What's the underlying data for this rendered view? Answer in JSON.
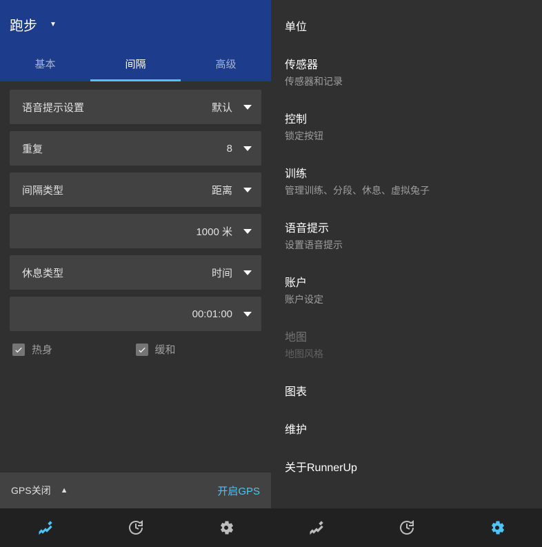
{
  "left": {
    "header": {
      "activity": "跑步"
    },
    "tabs": [
      {
        "label": "基本",
        "active": false
      },
      {
        "label": "间隔",
        "active": true
      },
      {
        "label": "高级",
        "active": false
      }
    ],
    "rows": [
      {
        "label": "语音提示设置",
        "value": "默认"
      },
      {
        "label": "重复",
        "value": "8"
      },
      {
        "label": "间隔类型",
        "value": "距离"
      },
      {
        "label": "",
        "value": "1000 米"
      },
      {
        "label": "休息类型",
        "value": "时间"
      },
      {
        "label": "",
        "value": "00:01:00"
      }
    ],
    "checks": {
      "warmup": "热身",
      "cooldown": "缓和"
    },
    "gps": {
      "status": "GPS关闭",
      "start": "开启GPS"
    }
  },
  "right": {
    "items": [
      {
        "title": "单位",
        "sub": ""
      },
      {
        "title": "传感器",
        "sub": "传感器和记录"
      },
      {
        "title": "控制",
        "sub": "锁定按钮"
      },
      {
        "title": "训练",
        "sub": "管理训练、分段、休息、虚拟兔子"
      },
      {
        "title": "语音提示",
        "sub": "设置语音提示"
      },
      {
        "title": "账户",
        "sub": "账户设定"
      },
      {
        "title": "地图",
        "sub": "地图风格",
        "disabled": true
      },
      {
        "title": "图表",
        "sub": ""
      },
      {
        "title": "维护",
        "sub": ""
      },
      {
        "title": "关于RunnerUp",
        "sub": ""
      }
    ]
  },
  "nav_left_active": 0,
  "nav_right_active": 2
}
